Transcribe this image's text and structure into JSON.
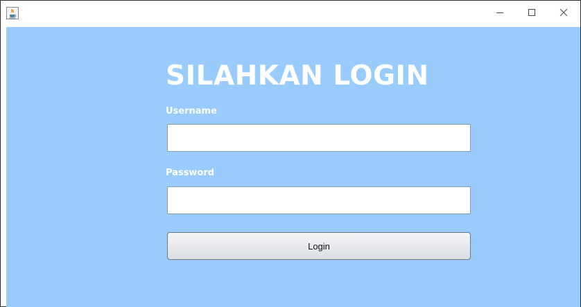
{
  "window": {
    "app_icon": "java-cup-icon",
    "controls": {
      "minimize_icon": "minimize-icon",
      "maximize_icon": "maximize-icon",
      "close_icon": "close-icon"
    }
  },
  "form": {
    "title": "SILAHKAN LOGIN",
    "username_label": "Username",
    "username_value": "",
    "password_label": "Password",
    "password_value": "",
    "login_button_label": "Login"
  },
  "colors": {
    "background": "#99cbfd",
    "title_text": "#ffffff",
    "label_text": "#ffffff"
  }
}
